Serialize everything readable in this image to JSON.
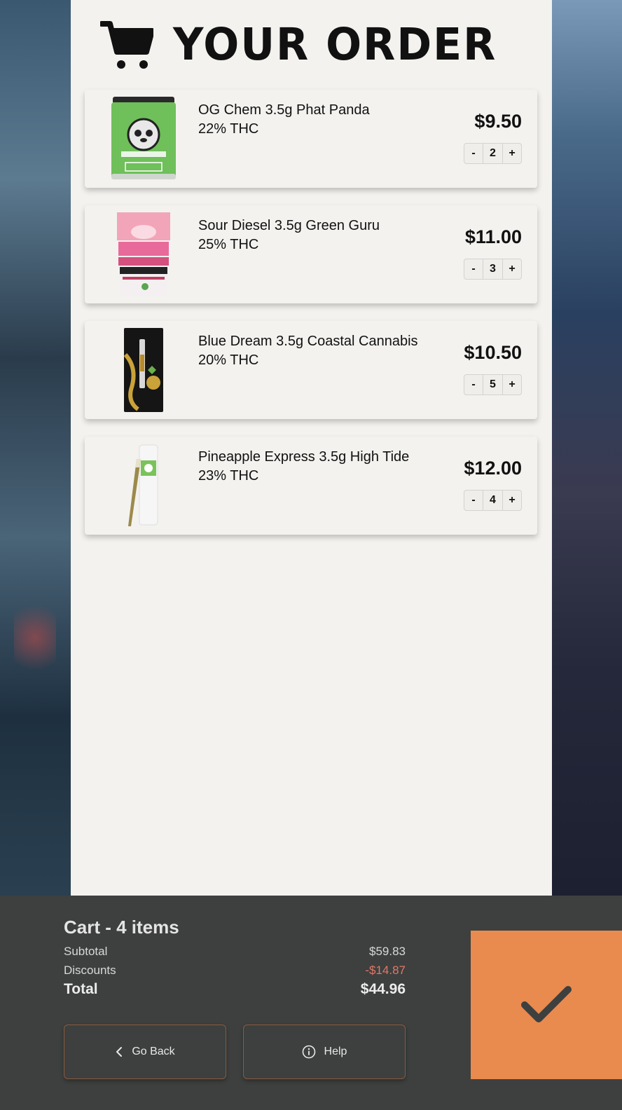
{
  "header": {
    "title": "YOUR ORDER",
    "icon": "cart-icon"
  },
  "items": [
    {
      "name": "OG Chem 3.5g Phat Panda",
      "thc": "22% THC",
      "price": "$9.50",
      "qty": "2",
      "minus": "-",
      "plus": "+",
      "image": "phat-panda-jar"
    },
    {
      "name": "Sour Diesel 3.5g Green Guru",
      "thc": "25% THC",
      "price": "$11.00",
      "qty": "3",
      "minus": "-",
      "plus": "+",
      "image": "panda-candies-bag"
    },
    {
      "name": "Blue Dream 3.5g Coastal Cannabis",
      "thc": "20% THC",
      "price": "$10.50",
      "qty": "5",
      "minus": "-",
      "plus": "+",
      "image": "herbs-oil-cartridge"
    },
    {
      "name": "Pineapple Express 3.5g High Tide",
      "thc": "23% THC",
      "price": "$12.00",
      "qty": "4",
      "minus": "-",
      "plus": "+",
      "image": "preroll-tube"
    }
  ],
  "footer": {
    "cart_title": "Cart - 4 items",
    "subtotal_label": "Subtotal",
    "subtotal_value": "$59.83",
    "discounts_label": "Discounts",
    "discounts_value": "-$14.87",
    "total_label": "Total",
    "total_value": "$44.96",
    "back_label": "Go Back",
    "help_label": "Help",
    "confirm_icon": "checkmark-icon"
  },
  "colors": {
    "panel": "#f3f2ef",
    "footer": "#3d403e",
    "accent": "#e98a4f",
    "discount": "#e2776a"
  }
}
